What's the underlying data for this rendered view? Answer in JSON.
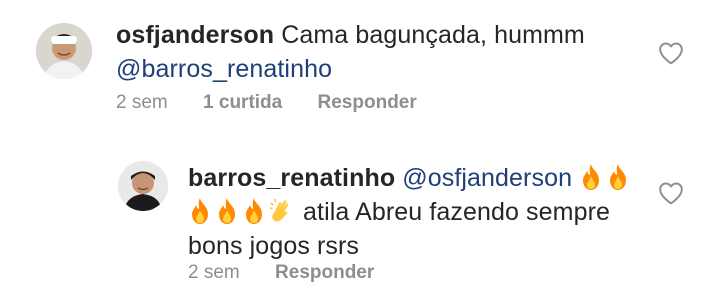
{
  "comments": [
    {
      "username": "osfjanderson",
      "text": " Cama bagunçada, hummm",
      "mention": "@barros_renatinho",
      "time": "2 sem",
      "likes": "1 curtida",
      "reply_label": "Responder",
      "avatar_icon": "user-avatar-photo",
      "like_icon": "heart-outline-icon"
    },
    {
      "username": "barros_renatinho",
      "mention": "@osfjanderson",
      "emojis_line1": [
        "fire",
        "fire"
      ],
      "emojis_line2": [
        "fire",
        "fire",
        "fire",
        "clapping-hands"
      ],
      "text": "atila Abreu fazendo sempre",
      "text_line3": "bons jogos rsrs",
      "time": "2 sem",
      "reply_label": "Responder",
      "avatar_icon": "user-avatar-photo",
      "like_icon": "heart-outline-icon"
    }
  ],
  "colors": {
    "text": "#262626",
    "mention": "#1f3f78",
    "meta": "#8e8e8e",
    "fire": "#ff8a00",
    "clap": "#ffc83d"
  }
}
